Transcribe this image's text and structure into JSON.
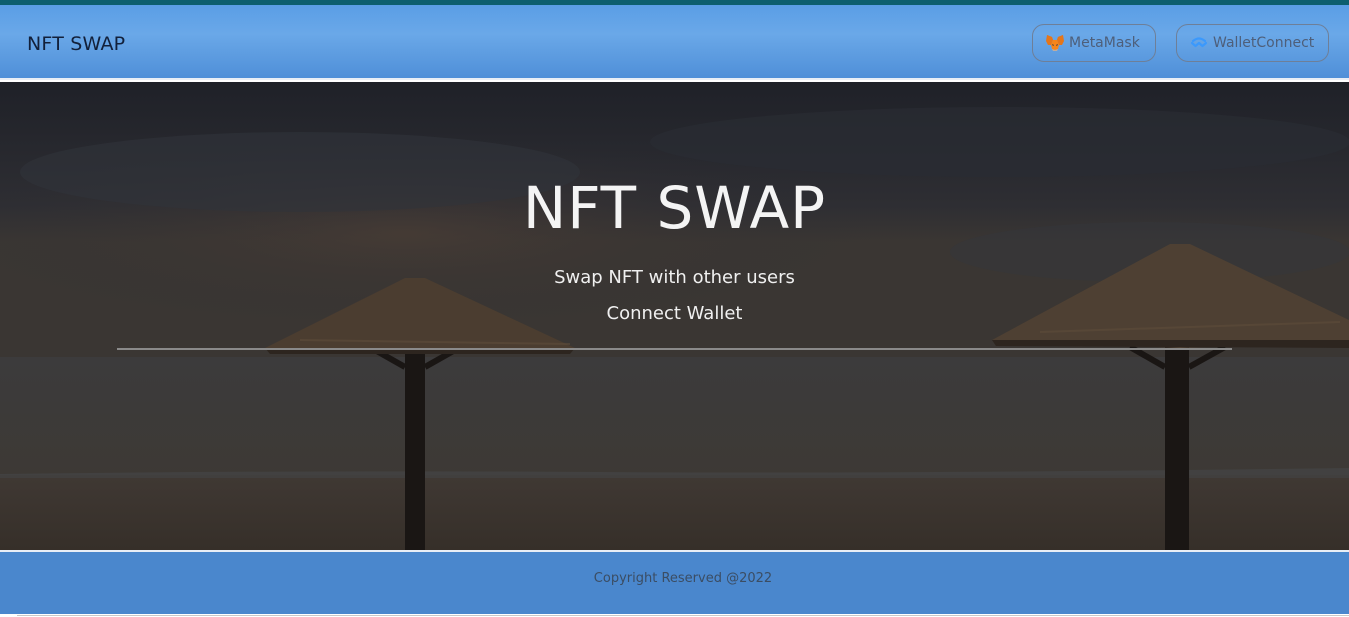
{
  "header": {
    "brand": "NFT SWAP",
    "buttons": [
      {
        "label": "MetaMask",
        "icon": "metamask-fox-icon"
      },
      {
        "label": "WalletConnect",
        "icon": "walletconnect-icon"
      }
    ]
  },
  "hero": {
    "title": "NFT SWAP",
    "subtitle": "Swap NFT with other users",
    "connect_label": "Connect Wallet"
  },
  "footer": {
    "copyright": "Copyright Reserved @2022"
  },
  "colors": {
    "navbar": "#5a9ee6",
    "footer": "#4a87cd",
    "top_strip": "#0d5f6f",
    "hero_text": "#f4f4f4"
  }
}
